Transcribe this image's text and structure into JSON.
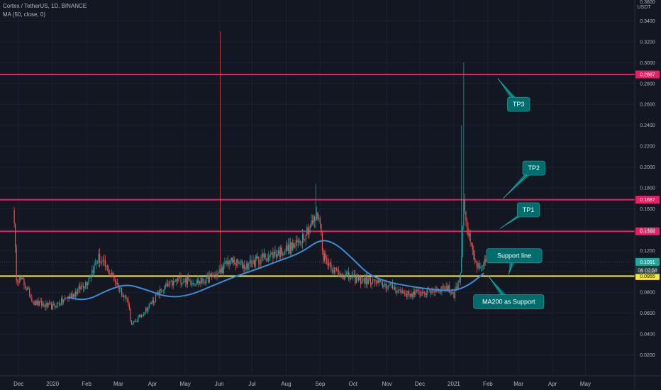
{
  "header": {
    "title": "Cortex / TetherUS, 1D, BINANCE",
    "indicator": "MA (50, close, 0)"
  },
  "colors": {
    "background": "#131722",
    "up": "#26a69a",
    "down": "#ef5350",
    "ma": "#3d8bd9",
    "resistance": "#e91e63",
    "support": "#f5e642",
    "callout": "#006d6d"
  },
  "axis": {
    "currency": "USDT",
    "top_label": "0.3600",
    "countdown": "06:07:58"
  },
  "chart_data": {
    "type": "candlestick",
    "symbol": "Cortex / TetherUS",
    "interval": "1D",
    "exchange": "BINANCE",
    "ylim": [
      0,
      0.36
    ],
    "x_range": [
      "2019-11-14",
      "2021-06-15"
    ],
    "y_ticks": [
      "0.0200",
      "0.0400",
      "0.0600",
      "0.0800",
      "0.1000",
      "0.1200",
      "0.1400",
      "0.1600",
      "0.1800",
      "0.2000",
      "0.2200",
      "0.2400",
      "0.2600",
      "0.2800",
      "0.3000",
      "0.3200",
      "0.3400"
    ],
    "x_ticks": [
      {
        "label": "Dec",
        "date": "2019-12-01"
      },
      {
        "label": "2020",
        "date": "2020-01-01"
      },
      {
        "label": "Feb",
        "date": "2020-02-01"
      },
      {
        "label": "Mar",
        "date": "2020-03-01"
      },
      {
        "label": "Apr",
        "date": "2020-04-01"
      },
      {
        "label": "May",
        "date": "2020-05-01"
      },
      {
        "label": "Jun",
        "date": "2020-06-01"
      },
      {
        "label": "Jul",
        "date": "2020-07-01"
      },
      {
        "label": "Aug",
        "date": "2020-08-01"
      },
      {
        "label": "Sep",
        "date": "2020-09-01"
      },
      {
        "label": "Oct",
        "date": "2020-10-01"
      },
      {
        "label": "Nov",
        "date": "2020-11-01"
      },
      {
        "label": "Dec",
        "date": "2020-12-01"
      },
      {
        "label": "2021",
        "date": "2021-01-01"
      },
      {
        "label": "Feb",
        "date": "2021-02-01"
      },
      {
        "label": "Mar",
        "date": "2021-03-01"
      },
      {
        "label": "Apr",
        "date": "2021-04-01"
      },
      {
        "label": "May",
        "date": "2021-05-01"
      }
    ],
    "price_anchors": [
      {
        "date": "2019-11-26",
        "value": 0.165
      },
      {
        "date": "2019-11-29",
        "value": 0.095
      },
      {
        "date": "2019-12-05",
        "value": 0.09
      },
      {
        "date": "2019-12-15",
        "value": 0.07
      },
      {
        "date": "2020-01-01",
        "value": 0.066
      },
      {
        "date": "2020-01-20",
        "value": 0.078
      },
      {
        "date": "2020-02-01",
        "value": 0.09
      },
      {
        "date": "2020-02-12",
        "value": 0.113
      },
      {
        "date": "2020-02-25",
        "value": 0.095
      },
      {
        "date": "2020-03-10",
        "value": 0.07
      },
      {
        "date": "2020-03-13",
        "value": 0.048
      },
      {
        "date": "2020-03-25",
        "value": 0.062
      },
      {
        "date": "2020-04-10",
        "value": 0.083
      },
      {
        "date": "2020-04-25",
        "value": 0.092
      },
      {
        "date": "2020-05-15",
        "value": 0.09
      },
      {
        "date": "2020-05-31",
        "value": 0.098
      },
      {
        "date": "2020-06-10",
        "value": 0.11
      },
      {
        "date": "2020-06-25",
        "value": 0.105
      },
      {
        "date": "2020-07-10",
        "value": 0.113
      },
      {
        "date": "2020-07-25",
        "value": 0.118
      },
      {
        "date": "2020-08-10",
        "value": 0.125
      },
      {
        "date": "2020-08-20",
        "value": 0.14
      },
      {
        "date": "2020-08-31",
        "value": 0.155
      },
      {
        "date": "2020-09-04",
        "value": 0.115
      },
      {
        "date": "2020-09-15",
        "value": 0.1
      },
      {
        "date": "2020-10-01",
        "value": 0.093
      },
      {
        "date": "2020-10-20",
        "value": 0.09
      },
      {
        "date": "2020-11-05",
        "value": 0.085
      },
      {
        "date": "2020-11-20",
        "value": 0.078
      },
      {
        "date": "2020-12-05",
        "value": 0.08
      },
      {
        "date": "2020-12-25",
        "value": 0.085
      },
      {
        "date": "2021-01-01",
        "value": 0.078
      },
      {
        "date": "2021-01-07",
        "value": 0.095
      },
      {
        "date": "2021-01-10",
        "value": 0.17
      },
      {
        "date": "2021-01-14",
        "value": 0.135
      },
      {
        "date": "2021-01-20",
        "value": 0.11
      },
      {
        "date": "2021-01-25",
        "value": 0.1
      },
      {
        "date": "2021-01-30",
        "value": 0.109
      }
    ],
    "wick_spikes": [
      {
        "date": "2020-06-02",
        "high": 0.33
      },
      {
        "date": "2020-08-28",
        "high": 0.184
      },
      {
        "date": "2021-01-10",
        "high": 0.3
      },
      {
        "date": "2021-01-08",
        "high": 0.24
      }
    ],
    "ma_series": {
      "name": "MA (50, close, 0)",
      "points": [
        {
          "date": "2020-01-15",
          "value": 0.075
        },
        {
          "date": "2020-02-01",
          "value": 0.072
        },
        {
          "date": "2020-02-20",
          "value": 0.082
        },
        {
          "date": "2020-03-08",
          "value": 0.088
        },
        {
          "date": "2020-03-25",
          "value": 0.083
        },
        {
          "date": "2020-04-15",
          "value": 0.075
        },
        {
          "date": "2020-05-05",
          "value": 0.077
        },
        {
          "date": "2020-05-25",
          "value": 0.086
        },
        {
          "date": "2020-06-15",
          "value": 0.095
        },
        {
          "date": "2020-07-05",
          "value": 0.102
        },
        {
          "date": "2020-07-25",
          "value": 0.11
        },
        {
          "date": "2020-08-15",
          "value": 0.118
        },
        {
          "date": "2020-09-01",
          "value": 0.131
        },
        {
          "date": "2020-09-15",
          "value": 0.127
        },
        {
          "date": "2020-10-01",
          "value": 0.112
        },
        {
          "date": "2020-10-15",
          "value": 0.097
        },
        {
          "date": "2020-11-01",
          "value": 0.09
        },
        {
          "date": "2020-11-20",
          "value": 0.086
        },
        {
          "date": "2020-12-10",
          "value": 0.083
        },
        {
          "date": "2021-01-01",
          "value": 0.081
        },
        {
          "date": "2021-01-15",
          "value": 0.087
        },
        {
          "date": "2021-01-28",
          "value": 0.098
        }
      ]
    },
    "horizontal_levels": [
      {
        "name": "TP3",
        "value": 0.2887,
        "label": "0.2887",
        "color": "#e91e63"
      },
      {
        "name": "TP2",
        "value": 0.1687,
        "label": "0.1687",
        "color": "#e91e63"
      },
      {
        "name": "TP1",
        "value": 0.1384,
        "label": "0.1384",
        "color": "#e91e63"
      },
      {
        "name": "Support line",
        "value": 0.0955,
        "label": "0.0955",
        "color": "#f5e642"
      }
    ],
    "current_price": {
      "value": 0.1091,
      "label": "0.1091"
    },
    "annotations": [
      {
        "text": "TP3",
        "box_date": "2021-03-01",
        "box_value": 0.26,
        "tip_date": "2021-02-10",
        "tip_value": 0.285
      },
      {
        "text": "TP2",
        "box_date": "2021-03-15",
        "box_value": 0.199,
        "tip_date": "2021-02-15",
        "tip_value": 0.17
      },
      {
        "text": "TP1",
        "box_date": "2021-03-10",
        "box_value": 0.159,
        "tip_date": "2021-02-12",
        "tip_value": 0.141
      },
      {
        "text": "Support line",
        "box_date": "2021-02-25",
        "box_value": 0.115,
        "tip_date": "2021-02-20",
        "tip_value": 0.097
      },
      {
        "text": "MA200 as Support",
        "box_date": "2021-02-20",
        "box_value": 0.071,
        "tip_date": "2021-02-01",
        "tip_value": 0.096
      }
    ]
  }
}
